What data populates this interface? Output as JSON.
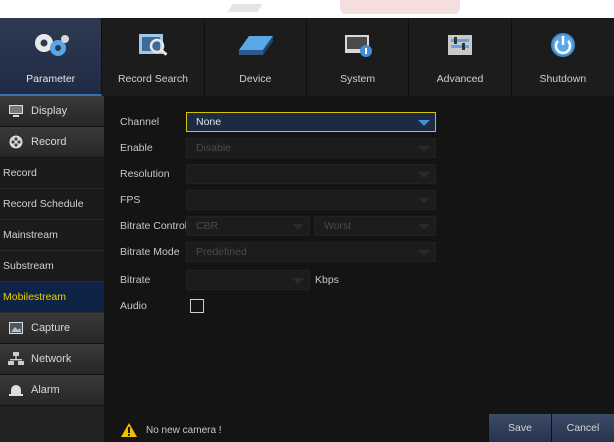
{
  "nav": {
    "items": [
      {
        "label": "Parameter",
        "icon": "gears-icon",
        "active": true
      },
      {
        "label": "Record Search",
        "icon": "record-search-icon",
        "active": false
      },
      {
        "label": "Device",
        "icon": "hard-drive-icon",
        "active": false
      },
      {
        "label": "System",
        "icon": "system-info-icon",
        "active": false
      },
      {
        "label": "Advanced",
        "icon": "advanced-settings-icon",
        "active": false
      },
      {
        "label": "Shutdown",
        "icon": "power-icon",
        "active": false
      }
    ]
  },
  "sidebar": {
    "display": "Display",
    "record": "Record",
    "record_items": [
      "Record",
      "Record Schedule",
      "Mainstream",
      "Substream",
      "Mobilestream"
    ],
    "capture": "Capture",
    "network": "Network",
    "alarm": "Alarm"
  },
  "form": {
    "channel_label": "Channel",
    "channel_value": "None",
    "enable_label": "Enable",
    "enable_value": "Disable",
    "resolution_label": "Resolution",
    "fps_label": "FPS",
    "bitrate_control_label": "Bitrate Control",
    "bitrate_control_value": "CBR",
    "quality_value": "Worst",
    "bitrate_mode_label": "Bitrate Mode",
    "bitrate_mode_value": "Predefined",
    "bitrate_label": "Bitrate",
    "bitrate_unit": "Kbps",
    "audio_label": "Audio"
  },
  "status": {
    "message": "No new camera !"
  },
  "buttons": {
    "save": "Save",
    "cancel": "Cancel"
  },
  "colors": {
    "accent": "#e6d200",
    "selected_bg": "#0f2346",
    "button": "#2f3d58"
  }
}
